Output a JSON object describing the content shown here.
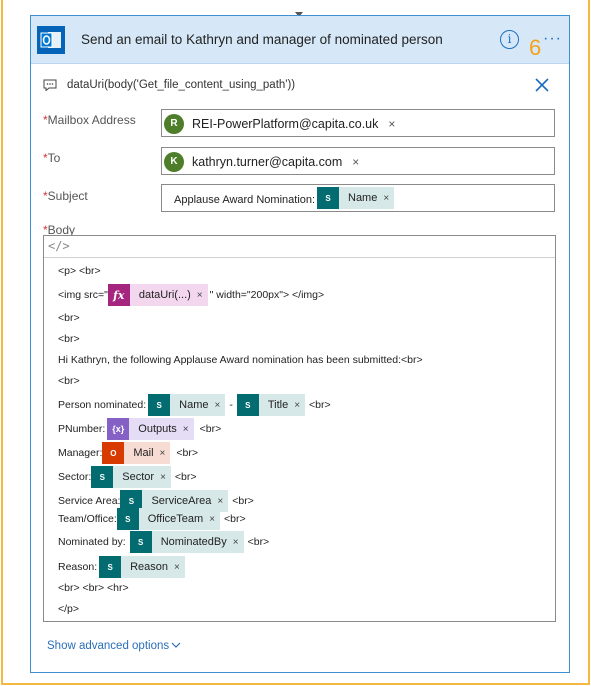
{
  "card": {
    "title": "Send an email to Kathryn and manager of nominated person",
    "step_number": "6",
    "more": "···",
    "info": "i",
    "note": "dataUri(body('Get_file_content_using_path'))"
  },
  "fields": {
    "mailbox_label": "Mailbox Address",
    "mailbox_initial": "R",
    "mailbox_value": "REI-PowerPlatform@capita.co.uk",
    "to_label": "To",
    "to_initial": "K",
    "to_value": "kathryn.turner@capita.com",
    "subject_label": "Subject",
    "subject_text": "Applause Award Nomination:",
    "subject_token": "Name",
    "body_label": "Body",
    "required_mark": "*",
    "remove": "×"
  },
  "body": {
    "code_icon": "</>",
    "line1": "<p> <br>",
    "img_open": "<img src=\"",
    "img_token": "dataUri(...)",
    "img_close": "\" width=\"200px\"> </img>",
    "br": "<br>",
    "greeting": "Hi Kathryn, the following Applause Award nomination has been submitted:<br>",
    "person_label": "Person nominated:",
    "person_token": "Name",
    "dash": "-",
    "title_token": "Title",
    "pnumber_label": "PNumber:",
    "pnumber_token": "Outputs",
    "manager_label": "Manager:",
    "manager_token": "Mail",
    "sector_label": "Sector:",
    "sector_token": "Sector",
    "service_label": "Service Area:",
    "service_token": "ServiceArea",
    "team_label": "Team/Office:",
    "team_token": "OfficeTeam",
    "nominated_label": "Nominated by:",
    "nominated_token": "NominatedBy",
    "reason_label": "Reason:",
    "reason_token": "Reason",
    "footer_line": "<br> <br> <hr>",
    "close_p": "</p>",
    "fx_symbol": "fx",
    "sp_symbol": "S",
    "var_symbol": "{x}",
    "office_symbol": "O"
  },
  "advanced_link": "Show advanced options"
}
